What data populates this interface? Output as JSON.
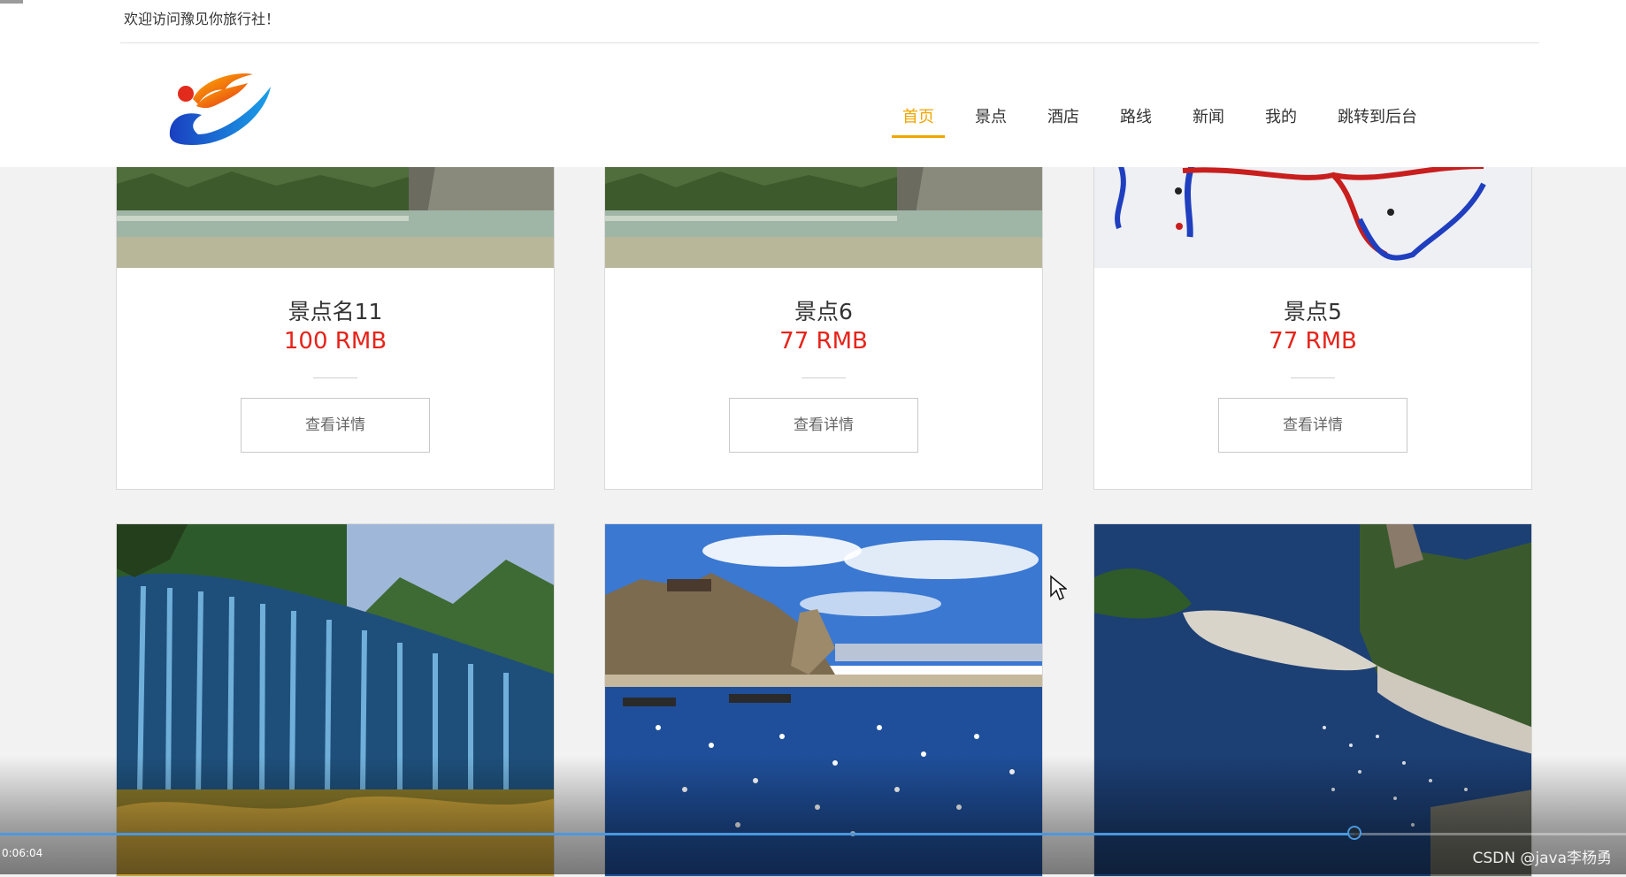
{
  "header": {
    "welcome": "欢迎访问豫见你旅行社！",
    "nav": [
      {
        "label": "首页",
        "active": true
      },
      {
        "label": "景点",
        "active": false
      },
      {
        "label": "酒店",
        "active": false
      },
      {
        "label": "路线",
        "active": false
      },
      {
        "label": "新闻",
        "active": false
      },
      {
        "label": "我的",
        "active": false
      },
      {
        "label": "跳转到后台",
        "active": false
      }
    ]
  },
  "cards_row1": [
    {
      "title": "景点名11",
      "price": "100 RMB",
      "button": "查看详情"
    },
    {
      "title": "景点6",
      "price": "77 RMB",
      "button": "查看详情"
    },
    {
      "title": "景点5",
      "price": "77 RMB",
      "button": "查看详情"
    }
  ],
  "video": {
    "time": "0:06:04",
    "progress_fraction": 0.833
  },
  "watermark": "CSDN @java李杨勇",
  "colors": {
    "accent": "#f0a500",
    "price": "#e7231a",
    "progress": "#4a98df"
  }
}
